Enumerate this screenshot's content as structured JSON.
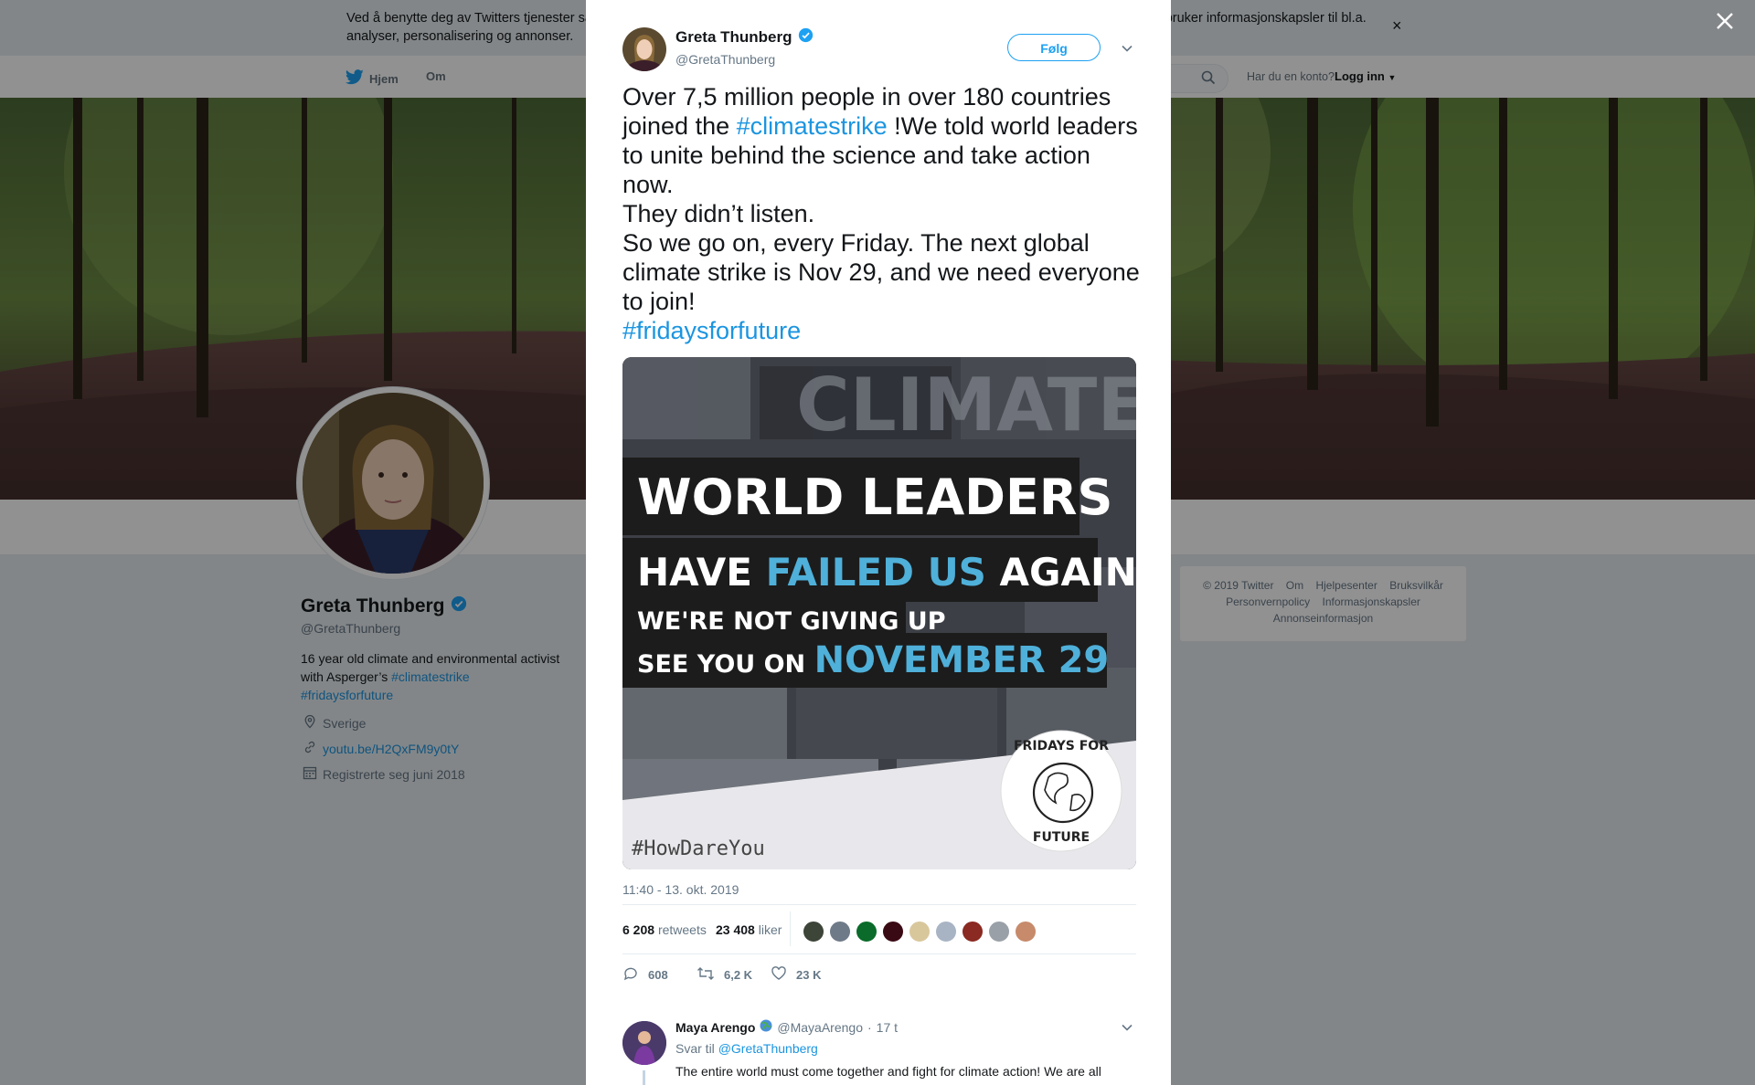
{
  "cookie_banner": {
    "text": "Ved å benytte deg av Twitters tjenester samtykker du i vår bruk av informasjonskapsler og deling av data med partnere. Vi og våre partnere bruker informasjonskapsler til bl.a. analyser, personalisering og annonser.",
    "close": "×"
  },
  "nav": {
    "home": "Hjem",
    "about": "Om",
    "account_question": "Har du en konto?",
    "login": "Logg inn"
  },
  "profile": {
    "name": "Greta Thunberg",
    "handle": "@GretaThunberg",
    "bio_text": "16 year old climate and environmental activist with Asperger’s",
    "bio_tag1": "#climatestrike",
    "bio_tag2": "#fridaysforfuture",
    "location": "Sverige",
    "url": "youtu.be/H2QxFM9y0tY",
    "joined": "Registrerte seg juni 2018"
  },
  "footer": {
    "links": [
      "© 2019 Twitter",
      "Om",
      "Hjelpesenter",
      "Bruksvilkår",
      "Personvernpolicy",
      "Informasjonskapsler",
      "Annonseinformasjon"
    ]
  },
  "overlay": {
    "close": "×"
  },
  "tweet": {
    "author_name": "Greta Thunberg",
    "author_handle": "@GretaThunberg",
    "follow_label": "Følg",
    "text_p1_a": "Over 7,5 million people in over 180 countries joined the ",
    "text_p1_tag": "#climatestrike",
    "text_p1_b": " !We told world leaders to unite behind the science and take action now.",
    "text_p2": "They didn’t listen.",
    "text_p3": "So we go on, every Friday. The next global climate strike is Nov 29, and we need everyone to join!",
    "text_p4_tag": "#fridaysforfuture",
    "media": {
      "bg_text": "CLIMATE AC",
      "line1": "WORLD LEADERS",
      "line2_a": "HAVE ",
      "line2_b": "FAILED US",
      "line2_c": " AGAIN",
      "line3": "WE'RE NOT GIVING UP",
      "line4_a": "SEE YOU ON ",
      "line4_b": "NOVEMBER 29",
      "hashtag": "#HowDareYou",
      "badge_top": "FRIDAYS FOR",
      "badge_bottom": "FUTURE"
    },
    "timestamp": "11:40 - 13. okt. 2019",
    "retweets_count": "6 208",
    "retweets_label": "retweets",
    "likes_count": "23 408",
    "likes_label": "liker",
    "reply_count": "608",
    "retweet_count_short": "6,2 K",
    "like_count_short": "23 K"
  },
  "reply": {
    "name": "Maya Arengo",
    "handle": "@MayaArengo",
    "dot": "·",
    "time": "17 t",
    "reply_to_label": "Svar til",
    "reply_to_handle": "@GretaThunberg",
    "text": "The entire world must come together and fight for climate action! We are all here and the future of our species is at stake. We have no time to waste!"
  },
  "colors": {
    "link": "#1b95e0",
    "follow": "#1da1f2",
    "verified": "#1da1f2",
    "media_accent": "#4fb0d9"
  }
}
